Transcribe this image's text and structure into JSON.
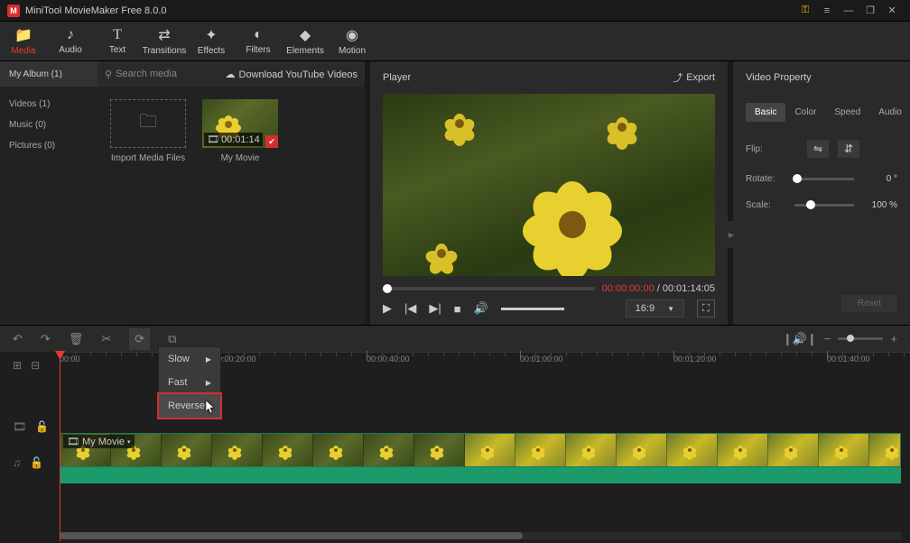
{
  "titlebar": {
    "title": "MiniTool MovieMaker Free 8.0.0"
  },
  "toolbar": {
    "items": [
      {
        "label": "Media",
        "icon": "📁"
      },
      {
        "label": "Audio",
        "icon": "♪"
      },
      {
        "label": "Text",
        "icon": "T"
      },
      {
        "label": "Transitions",
        "icon": "⇄"
      },
      {
        "label": "Effects",
        "icon": "✦"
      },
      {
        "label": "Filters",
        "icon": "◐"
      },
      {
        "label": "Elements",
        "icon": "◆"
      },
      {
        "label": "Motion",
        "icon": "◉"
      }
    ]
  },
  "album": {
    "name": "My Album (1)",
    "search_placeholder": "Search media",
    "download_label": "Download YouTube Videos",
    "sidebar": [
      {
        "label": "Videos (1)"
      },
      {
        "label": "Music (0)"
      },
      {
        "label": "Pictures (0)"
      }
    ],
    "tiles": {
      "import": "Import Media Files",
      "movie": {
        "label": "My Movie",
        "duration": "00:01:14"
      }
    }
  },
  "player": {
    "title": "Player",
    "export": "Export",
    "time_current": "00:00:00:00",
    "time_total": "00:01:14:05",
    "aspect": "16:9"
  },
  "props": {
    "title": "Video Property",
    "tabs": [
      "Basic",
      "Color",
      "Speed",
      "Audio"
    ],
    "flip_label": "Flip:",
    "rotate_label": "Rotate:",
    "rotate_value": "0 °",
    "scale_label": "Scale:",
    "scale_value": "100 %",
    "reset": "Reset"
  },
  "timeline": {
    "marks": [
      "00:00",
      "00:00:20:00",
      "00:00:40:00",
      "00:01:00:00",
      "00:01:20:00",
      "00:01:40:00"
    ],
    "clip_label": "My Movie"
  },
  "speed_menu": {
    "items": [
      "Slow",
      "Fast",
      "Reverse"
    ]
  }
}
